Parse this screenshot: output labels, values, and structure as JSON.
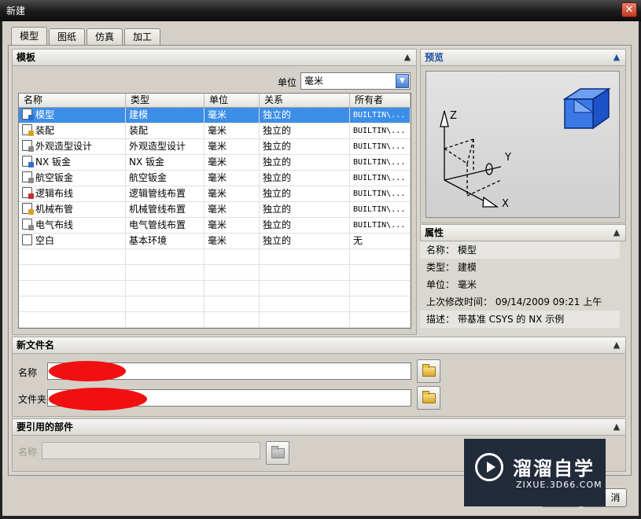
{
  "window": {
    "title": "新建",
    "close_glyph": "✕"
  },
  "tabs": [
    {
      "label": "模型",
      "active": true
    },
    {
      "label": "图纸",
      "active": false
    },
    {
      "label": "仿真",
      "active": false
    },
    {
      "label": "加工",
      "active": false
    }
  ],
  "templates": {
    "header": "模板",
    "unit_label": "单位",
    "unit_value": "毫米",
    "columns": [
      "名称",
      "类型",
      "单位",
      "关系",
      "所有者"
    ],
    "rows": [
      {
        "icon": "model-icon",
        "name": "模型",
        "type": "建模",
        "unit": "毫米",
        "relation": "独立的",
        "owner": "BUILTIN\\...",
        "selected": true
      },
      {
        "icon": "assembly-icon",
        "name": "装配",
        "type": "装配",
        "unit": "毫米",
        "relation": "独立的",
        "owner": "BUILTIN\\...",
        "selected": false
      },
      {
        "icon": "shape-studio-icon",
        "name": "外观造型设计",
        "type": "外观造型设计",
        "unit": "毫米",
        "relation": "独立的",
        "owner": "BUILTIN\\...",
        "selected": false
      },
      {
        "icon": "sheet-metal-icon",
        "name": "NX 钣金",
        "type": "NX 钣金",
        "unit": "毫米",
        "relation": "独立的",
        "owner": "BUILTIN\\...",
        "selected": false
      },
      {
        "icon": "aero-sheet-metal-icon",
        "name": "航空钣金",
        "type": "航空钣金",
        "unit": "毫米",
        "relation": "独立的",
        "owner": "BUILTIN\\...",
        "selected": false
      },
      {
        "icon": "logical-routing-icon",
        "name": "逻辑布线",
        "type": "逻辑管线布置",
        "unit": "毫米",
        "relation": "独立的",
        "owner": "BUILTIN\\...",
        "selected": false
      },
      {
        "icon": "mechanical-routing-icon",
        "name": "机械布管",
        "type": "机械管线布置",
        "unit": "毫米",
        "relation": "独立的",
        "owner": "BUILTIN\\...",
        "selected": false
      },
      {
        "icon": "electrical-routing-icon",
        "name": "电气布线",
        "type": "电气管线布置",
        "unit": "毫米",
        "relation": "独立的",
        "owner": "BUILTIN\\...",
        "selected": false
      },
      {
        "icon": "blank-icon",
        "name": "空白",
        "type": "基本环境",
        "unit": "毫米",
        "relation": "独立的",
        "owner": "无",
        "selected": false
      }
    ]
  },
  "preview": {
    "header": "预览",
    "axes": {
      "z": "Z",
      "y": "Y",
      "x": "X"
    }
  },
  "properties": {
    "header": "属性",
    "items": [
      {
        "text": "名称： 模型"
      },
      {
        "text": "类型： 建模"
      },
      {
        "text": "单位： 毫米"
      },
      {
        "text": "上次修改时间： 09/14/2009 09:21 上午"
      },
      {
        "text": "描述： 带基准 CSYS 的 NX 示例"
      }
    ]
  },
  "new_file": {
    "header": "新文件名",
    "name_label": "名称",
    "folder_label": "文件夹"
  },
  "referenced": {
    "header": "要引用的部件",
    "name_label": "名称"
  },
  "buttons": {
    "cancel": "消"
  },
  "watermark": {
    "title": "溜溜自学",
    "subtitle": "ZIXUE.3D66.COM"
  },
  "colors": {
    "selection": "#3d8ee8",
    "redaction": "#f01010",
    "header_blue": "#1a4fa0"
  }
}
